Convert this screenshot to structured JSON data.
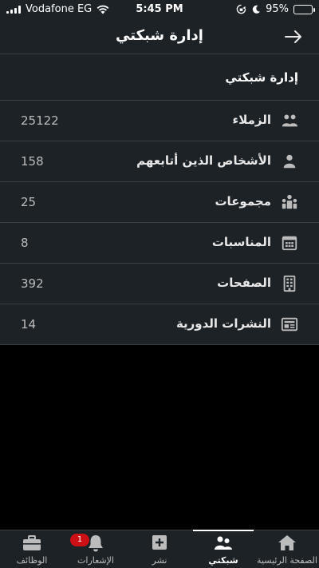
{
  "status_bar": {
    "carrier": "Vodafone EG",
    "time": "5:45 PM",
    "battery": "95%",
    "battery_level": 0.95
  },
  "header": {
    "title": "إدارة شبكتي",
    "back_icon": "arrow-right-icon"
  },
  "section": {
    "title": "إدارة شبكتي",
    "rows": [
      {
        "label": "الزملاء",
        "count": "25122",
        "icon": "people-icon"
      },
      {
        "label": "الأشخاص الذين أتابعهم",
        "count": "158",
        "icon": "person-icon"
      },
      {
        "label": "مجموعات",
        "count": "25",
        "icon": "group-icon"
      },
      {
        "label": "المناسبات",
        "count": "8",
        "icon": "calendar-icon"
      },
      {
        "label": "الصفحات",
        "count": "392",
        "icon": "building-icon"
      },
      {
        "label": "النشرات الدورية",
        "count": "14",
        "icon": "newsletter-icon"
      }
    ]
  },
  "tabbar": {
    "tabs": [
      {
        "label": "الصفحة الرئيسية",
        "icon": "home-icon"
      },
      {
        "label": "شبكتي",
        "icon": "my-network-icon",
        "active": true
      },
      {
        "label": "نشر",
        "icon": "plus-square-icon"
      },
      {
        "label": "الإشعارات",
        "icon": "bell-icon",
        "badge": "1"
      },
      {
        "label": "الوظائف",
        "icon": "briefcase-icon"
      }
    ]
  },
  "colors": {
    "background": "#000000",
    "surface": "#1d2226",
    "divider": "#3a3f43",
    "muted_text": "#bcbcbc",
    "badge": "#cc1016"
  }
}
